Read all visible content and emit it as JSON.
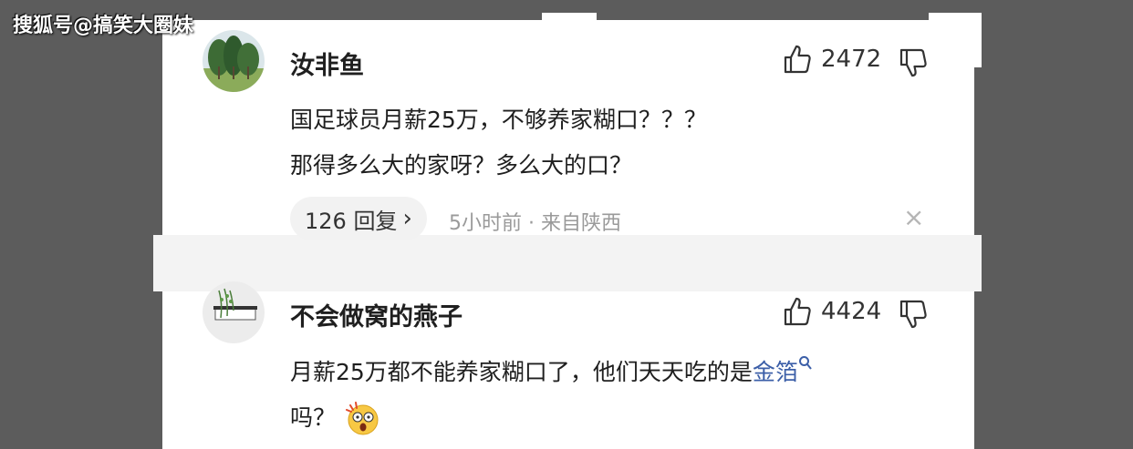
{
  "watermark": "搜狐号@搞笑大圈妹",
  "comments": [
    {
      "username": "汝非鱼",
      "likes": "2472",
      "lines": [
        "国足球员月薪25万，不够养家糊口？？？",
        "那得多么大的家呀？多么大的口？"
      ],
      "reply_label": "126 回复",
      "reply_chevron": "›",
      "meta": "5小时前 · 来自陕西",
      "close": "×"
    },
    {
      "username": "不会做窝的燕子",
      "likes": "4424",
      "line1_text": "月薪25万都不能养家糊口了，他们天天吃的是",
      "line1_link": "金箔",
      "line2": "吗？",
      "emoji": "shocked-emoji"
    }
  ],
  "colors": {
    "background": "#5c5c5c",
    "link": "#3c5fa8"
  }
}
